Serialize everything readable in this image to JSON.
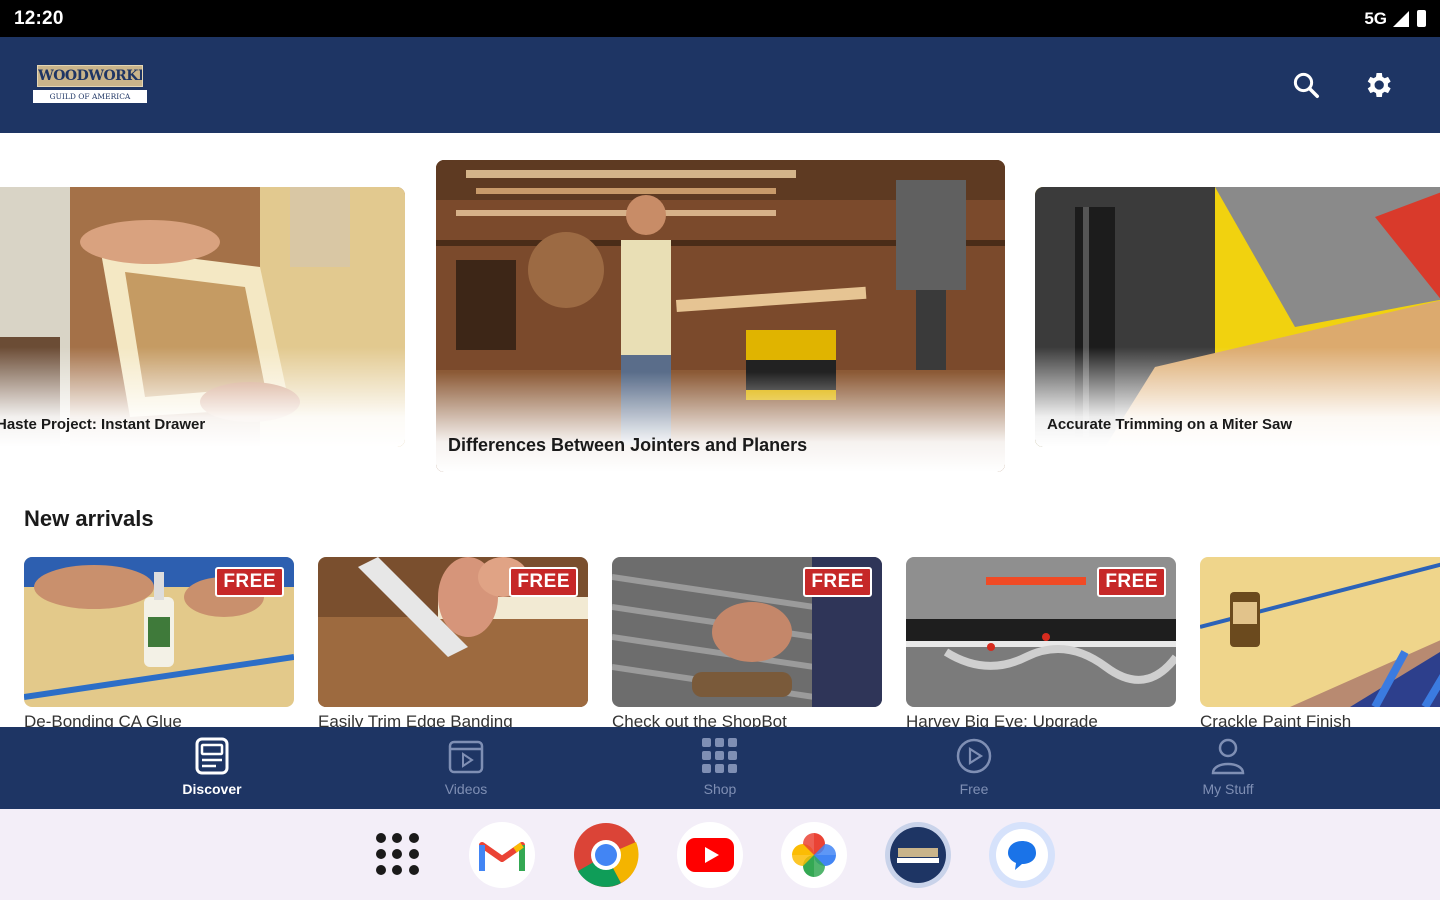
{
  "status_bar": {
    "time": "12:20",
    "network": "5G"
  },
  "header": {
    "logo_line1": "WOODWORKERS",
    "logo_line2": "GUILD OF AMERICA",
    "search_icon": "search-icon",
    "settings_icon": "gear-icon",
    "color": "#1e3564"
  },
  "carousel": {
    "slides": [
      {
        "title": "Haste Project: Instant Drawer"
      },
      {
        "title": "Differences Between Jointers and Planers"
      },
      {
        "title": "Accurate Trimming on a Miter Saw"
      }
    ]
  },
  "new_arrivals": {
    "heading": "New arrivals",
    "items": [
      {
        "title": "De-Bonding CA Glue",
        "badge": "FREE"
      },
      {
        "title": "Easily Trim Edge Banding",
        "badge": "FREE"
      },
      {
        "title": "Check out the ShopBot",
        "badge": "FREE"
      },
      {
        "title": "Harvey Big Eye: Upgrade",
        "badge": "FREE"
      },
      {
        "title": "Crackle Paint Finish",
        "badge": ""
      }
    ]
  },
  "bottom_nav": {
    "items": [
      {
        "label": "Discover",
        "icon": "discover-icon",
        "active": true
      },
      {
        "label": "Videos",
        "icon": "video-icon",
        "active": false
      },
      {
        "label": "Shop",
        "icon": "grid-icon",
        "active": false
      },
      {
        "label": "Free",
        "icon": "play-circle-icon",
        "active": false
      },
      {
        "label": "My Stuff",
        "icon": "person-icon",
        "active": false
      }
    ]
  },
  "dock": {
    "apps": [
      "app-drawer-icon",
      "gmail-icon",
      "chrome-icon",
      "youtube-icon",
      "photos-icon",
      "wwga-app-icon",
      "messages-icon"
    ]
  }
}
